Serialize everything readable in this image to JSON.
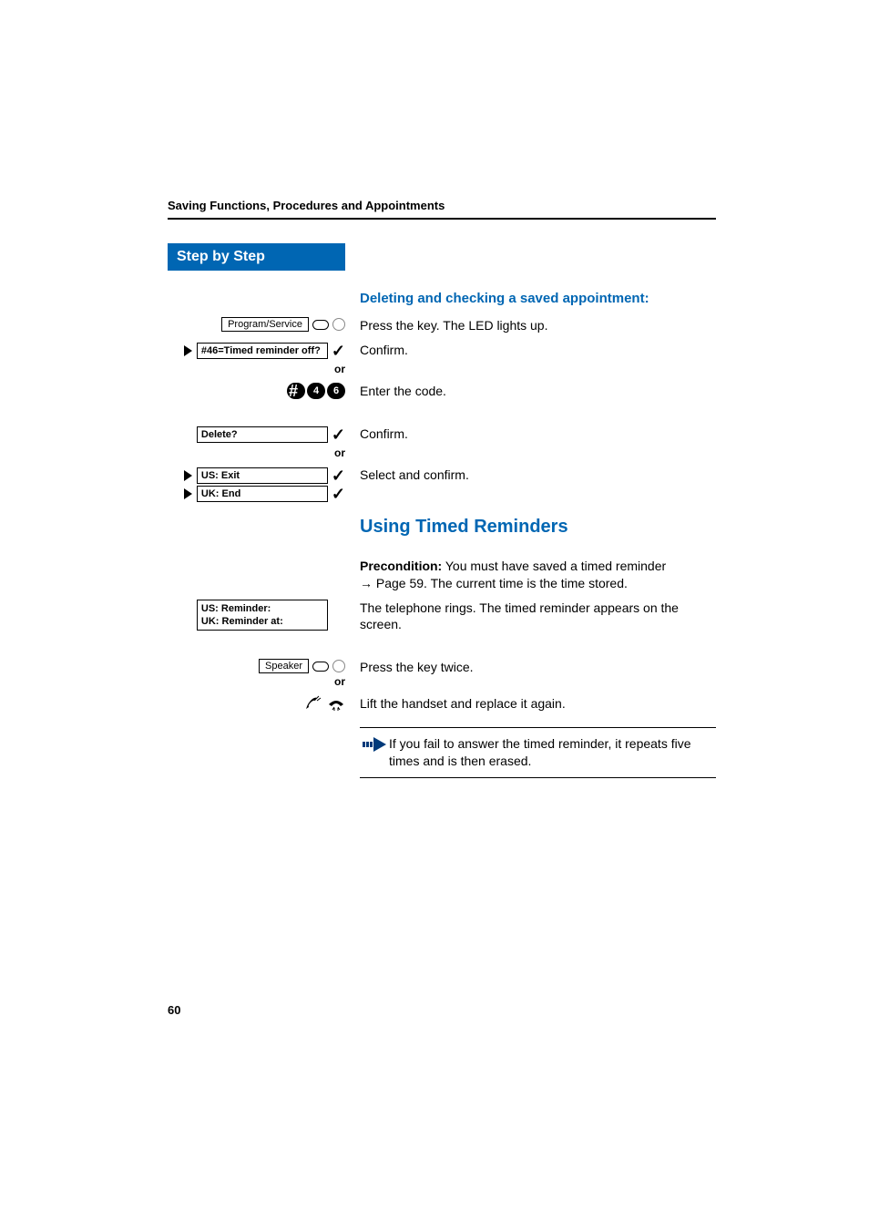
{
  "header": {
    "title": "Saving Functions, Procedures and Appointments"
  },
  "step_bar": "Step by Step",
  "subheading1": "Deleting and checking a saved appointment:",
  "rows": {
    "program_service_key": "Program/Service",
    "press_led": "Press the key. The LED lights up.",
    "timed_reminder_off": "#46=Timed reminder off?",
    "confirm1": "Confirm.",
    "or1": "or",
    "dial_keys": [
      "#",
      "4",
      "6"
    ],
    "enter_code": "Enter the code.",
    "delete": "Delete?",
    "confirm2": "Confirm.",
    "or2": "or",
    "us_exit": "US: Exit",
    "uk_end": "UK: End",
    "select_confirm": "Select and confirm."
  },
  "section2": {
    "heading": "Using Timed Reminders",
    "precondition_label": "Precondition:",
    "precondition_text": " You must have saved a timed reminder ",
    "precondition_ref": " Page 59. The current time is the time stored.",
    "us_reminder": "US: Reminder:",
    "uk_reminder": "UK: Reminder at:",
    "ring_text": "The telephone rings. The timed reminder appears on the screen.",
    "speaker_key": "Speaker",
    "press_twice": "Press the key twice.",
    "or3": "or",
    "lift_handset": "Lift the handset and replace it again.",
    "note": "If you fail to answer the timed reminder, it repeats five times and is then erased."
  },
  "page_number": "60"
}
